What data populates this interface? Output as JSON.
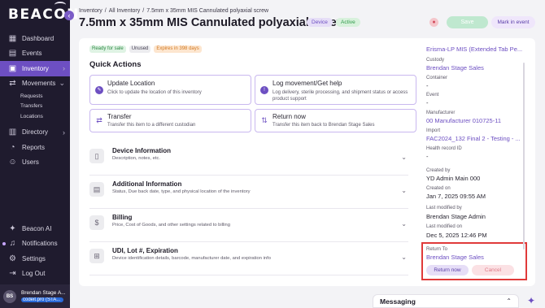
{
  "sidebar": {
    "logo": "BEACON",
    "collapse_icon": "chevron-left-icon",
    "items": [
      {
        "label": "Dashboard",
        "icon": "dashboard-icon"
      },
      {
        "label": "Events",
        "icon": "calendar-icon"
      },
      {
        "label": "Inventory",
        "icon": "inventory-icon",
        "active": true
      },
      {
        "label": "Movements",
        "icon": "movements-icon"
      },
      {
        "label": "Directory",
        "icon": "directory-icon"
      },
      {
        "label": "Reports",
        "icon": "reports-icon"
      },
      {
        "label": "Users",
        "icon": "users-icon"
      }
    ],
    "sub_items": [
      {
        "label": "Requests"
      },
      {
        "label": "Transfers"
      },
      {
        "label": "Locations"
      }
    ],
    "bottom_items": [
      {
        "label": "Beacon AI",
        "icon": "sparkle-icon"
      },
      {
        "label": "Notifications",
        "icon": "bell-icon"
      },
      {
        "label": "Settings",
        "icon": "gear-icon"
      },
      {
        "label": "Log Out",
        "icon": "logout-icon"
      }
    ],
    "user": {
      "initials": "BS",
      "name": "Brendan Stage A...",
      "org": "codeit.pro (STA..."
    }
  },
  "header": {
    "breadcrumb": [
      "Inventory",
      "All Inventory",
      "7.5mm x 35mm MIS Cannulated polyaxial screw"
    ],
    "title": "7.5mm x 35mm MIS Cannulated polyaxial screw",
    "tags": [
      "Device",
      "Active"
    ],
    "save_label": "Save",
    "mark_label": "Mark in event"
  },
  "status_chips": [
    "Ready for sale",
    "Unused",
    "Expires in 398 days"
  ],
  "quick_actions": {
    "title": "Quick Actions",
    "cards": [
      {
        "title": "Update Location",
        "desc": "Click to update the location of this inventory",
        "icon": "location-icon"
      },
      {
        "title": "Log movement/Get help",
        "desc": "Log delivery, sterile processing, and shipment status or access product support",
        "icon": "info-icon"
      },
      {
        "title": "Transfer",
        "desc": "Transfer this item to a different custodian",
        "icon": "transfer-icon"
      },
      {
        "title": "Return now",
        "desc": "Transfer this item back to Brendan Stage Sales",
        "icon": "return-icon"
      }
    ]
  },
  "sections": [
    {
      "title": "Device Information",
      "desc": "Description, notes, etc.",
      "icon": "device-icon"
    },
    {
      "title": "Additional Information",
      "desc": "Status, Due back date, type, and physical location of the inventory",
      "icon": "document-icon"
    },
    {
      "title": "Billing",
      "desc": "Price, Cost of Goods, and other settings related to billing",
      "icon": "dollar-icon"
    },
    {
      "title": "UDI, Lot #, Expiration",
      "desc": "Device identification details, barcode, manufacturer date, and expiration info",
      "icon": "barcode-icon"
    }
  ],
  "side_panel": {
    "product": "Erisma-LP MIS (Extended Tab Pe...",
    "custody_label": "Custody",
    "custody_value": "Brendan Stage Sales",
    "container_label": "Container",
    "container_value": "-",
    "event_label": "Event",
    "event_value": "-",
    "manufacturer_label": "Manufacturer",
    "manufacturer_value": "00 Manufacturer 010725-11",
    "import_label": "Import",
    "import_value": "FAC2024_132 Final 2 - Testing - ...",
    "health_label": "Health record ID",
    "health_value": "-",
    "created_by_label": "Created by",
    "created_by_value": "YD Admin Main 000",
    "created_on_label": "Created on",
    "created_on_value": "Jan 7, 2025 09:55 AM",
    "modified_by_label": "Last modified by",
    "modified_by_value": "Brendan Stage Admin",
    "modified_on_label": "Last modified on",
    "modified_on_value": "Dec 5, 2025 12:46 PM",
    "return_to_label": "Return To",
    "return_to_value": "Brendan Stage Sales",
    "return_now_label": "Return now",
    "cancel_label": "Cancel"
  },
  "messaging": {
    "title": "Messaging",
    "icon": "chevron-up-icon"
  },
  "colors": {
    "accent": "#6d4fc2",
    "sidebar": "#1f1b2e",
    "highlight": "#e03a3a"
  }
}
